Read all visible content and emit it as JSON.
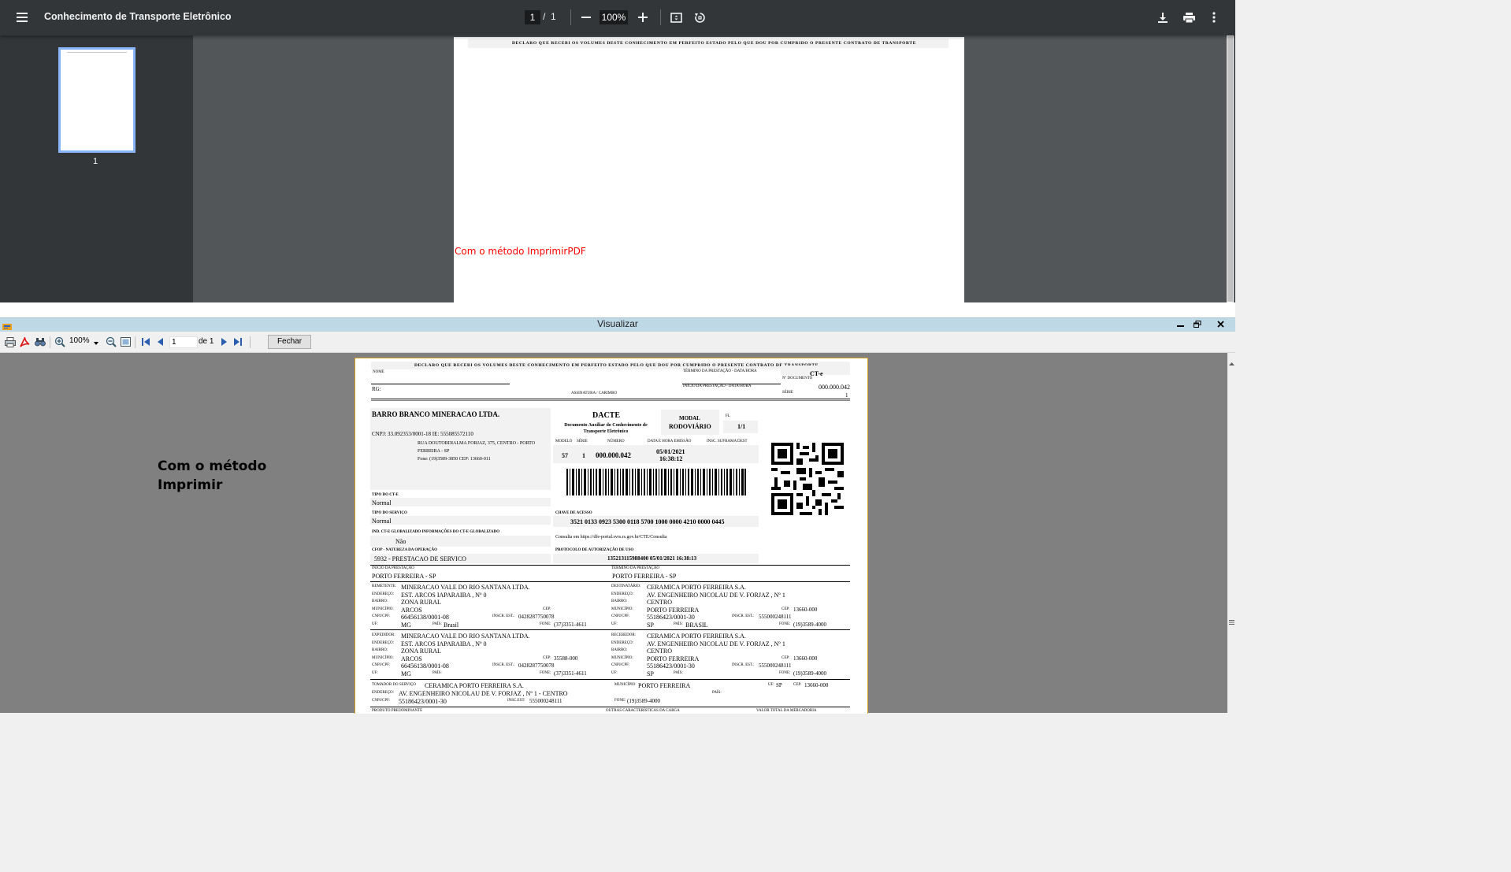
{
  "pdf_viewer": {
    "title": "Conhecimento de Transporte Eletrônico",
    "page_current": "1",
    "page_sep": "/",
    "page_total": "1",
    "zoom": "100%",
    "thumbnail_number": "1",
    "page_header": "DECLARO QUE RECEBI OS VOLUMES DESTE CONHECIMENTO EM PERFEITO ESTADO PELO QUE DOU POR CUMPRIDO O PRESENTE CONTRATO DE TRANSPORTE",
    "annotation": "Com o método ImprimirPDF"
  },
  "report_viewer": {
    "window_title": "Visualizar",
    "zoom": "100%",
    "page_input": "1",
    "page_of": "de 1",
    "close_button": "Fechar",
    "annotation_line1": "Com o método",
    "annotation_line2": "Imprimir"
  },
  "dacte": {
    "declaration": "DECLARO QUE RECEBI OS VOLUMES DESTE CONHECIMENTO EM PERFEITO ESTADO PELO QUE DOU POR CUMPRIDO O PRESENTE CONTRATO DE TRANSPORTE",
    "nome_label": "NOME",
    "rg_label": "RG:",
    "assinatura_label": "ASSINATURA / CARIMBO",
    "termino_label": "TÉRMINO DA PRESTAÇÃO - DATA/HORA",
    "inicio_label": "INÍCIO DA PRESTAÇÃO - DATA/HORA",
    "cte_label": "CT-e",
    "ndoc_label": "Nº DOCUMENTO",
    "ndoc_value": "000.000.042",
    "serie_label": "SÉRIE",
    "serie_value": "1",
    "emitente_name": "BARRO BRANCO MINERACAO LTDA.",
    "emitente_cnpj": "CNPJ: 33.092353/0001-18 IE: 555085572110",
    "emitente_addr1": "RUA DOUTORDIALMA FORJAZ, 375, CENTRO - PORTO",
    "emitente_addr2": "FERREIRA - SP",
    "emitente_fone": "Fone: (19)3589-3850 CEP: 13660-011",
    "dacte_title": "DACTE",
    "dacte_subtitle1": "Documento Auxiliar do Conhecimento de",
    "dacte_subtitle2": "Transporte Eletrônico",
    "modal_label": "MODAL",
    "modal_value": "RODOVIÁRIO",
    "fl_label": "FL",
    "fl_value": "1/1",
    "modelo_label": "MODELO",
    "serie2_label": "SÉRIE",
    "numero_label": "NÚMERO",
    "emissao_label": "DATA E HORA EMISSÃO",
    "suframa_label": "INSC. SUFRAMA DEST",
    "modelo_value": "57",
    "serie2_value": "1",
    "numero_value": "000.000.042",
    "emissao_date": "05/01/2021",
    "emissao_time": "16:38:12",
    "tipo_cte_label": "TIPO DO CT-E",
    "tipo_cte_value": "Normal",
    "tipo_servico_label": "TIPO DO SERVIÇO",
    "tipo_servico_value": "Normal",
    "globalizado_label": "IND. CT-E GLOBALIZADO   INFORMAÇÕES DO CT-E GLOBALIZADO",
    "globalizado_value": "Não",
    "cfop_label": "CFOP - NATUREZA DA OPERAÇÃO",
    "cfop_value": "5932 - PRESTACAO DE SERVICO",
    "chave_label": "CHAVE DE ACESSO",
    "chave_value": "3521 0133 0923 5300 0118 5700 1000 0000 4210 0000 0445",
    "consulta_text": "Consulta em   https://dfe-portal.svrs.rs.gov.br/CTE/Consulta",
    "protocolo_label": "PROTOCOLO DE AUTORIZAÇÃO DE USO",
    "protocolo_value": "135213115988400 05/01/2021 16:38:13",
    "inicio_prest_label": "INÍCIO DA PRESTAÇÃO",
    "inicio_prest_value": "PORTO FERREIRA - SP",
    "termino_prest_label": "TÉRMINO DA PRESTAÇÃO",
    "termino_prest_value": "PORTO FERREIRA - SP",
    "lbl_endereco": "ENDEREÇO:",
    "lbl_bairro": "BAIRRO:",
    "lbl_municipio": "MUNICÍPIO:",
    "lbl_cnpj": "CNPJ/CPF:",
    "lbl_uf": "UF:",
    "lbl_cep": "CEP:",
    "lbl_inscr": "INSCR. EST.:",
    "lbl_pais": "PAÍS:",
    "lbl_fone": "FONE:",
    "remetente": {
      "label": "REMETENTE:",
      "nome": "MINERACAO VALE DO RIO SANTANA LTDA.",
      "endereco": "EST. ARCOS IAPARAIBA , Nº 0",
      "bairro": "ZONA RURAL",
      "municipio": "ARCOS",
      "cnpj": "66456138/0001-08",
      "inscr": "0428287750078",
      "uf": "MG",
      "pais": "Brasil",
      "fone": "(37)3351-4611",
      "cep": ""
    },
    "destinatario": {
      "label": "DESTINATÁRIO:",
      "nome": "CERAMICA PORTO FERREIRA S.A.",
      "endereco": "AV. ENGENHEIRO NICOLAU DE V. FORJAZ , Nº 1",
      "bairro": "CENTRO",
      "municipio": "PORTO FERREIRA",
      "cep": "13660-000",
      "cnpj": "55186423/0001-30",
      "inscr": "555000248111",
      "uf": "SP",
      "pais": "BRASIL",
      "fone": "(19)3589-4000"
    },
    "expedidor": {
      "label": "EXPEDIDOR:",
      "nome": "MINERACAO VALE DO RIO SANTANA LTDA.",
      "endereco": "EST. ARCOS IAPARAIBA , Nº 0",
      "bairro": "ZONA RURAL",
      "municipio": "ARCOS",
      "cep": "35588-000",
      "cnpj": "66456138/0001-08",
      "inscr": "0428287750078",
      "uf": "MG",
      "pais": "",
      "fone": "(37)3351-4611"
    },
    "recebedor": {
      "label": "RECEBEDOR:",
      "nome": "CERAMICA PORTO FERREIRA S.A.",
      "endereco": "AV. ENGENHEIRO NICOLAU DE V. FORJAZ , Nº 1",
      "bairro": "CENTRO",
      "municipio": "PORTO FERREIRA",
      "cep": "13660-000",
      "cnpj": "55186423/0001-30",
      "inscr": "555000248111",
      "uf": "SP",
      "pais": "",
      "fone": "(19)3589-4000"
    },
    "tomador": {
      "label": "TOMADOR DO SERVIÇO",
      "nome": "CERAMICA PORTO FERREIRA S.A.",
      "municipio_label": "MUNICÍPIO",
      "municipio": "PORTO FERREIRA",
      "uf": "SP",
      "cep": "13660-000",
      "endereco": "AV. ENGENHEIRO NICOLAU DE V. FORJAZ , Nº 1  - CENTRO",
      "cnpj": "55186423/0001-30",
      "inscr_label": "INSC.EST:",
      "inscr": "555000248111",
      "fone": "(19)3589-4000"
    },
    "produto_label": "PRODUTO PREDOMINANTE",
    "outras_label": "OUTRAS CARACTERÍSTICAS DA CARGA",
    "valor_label": "VALOR TOTAL DA MERCADORIA"
  }
}
